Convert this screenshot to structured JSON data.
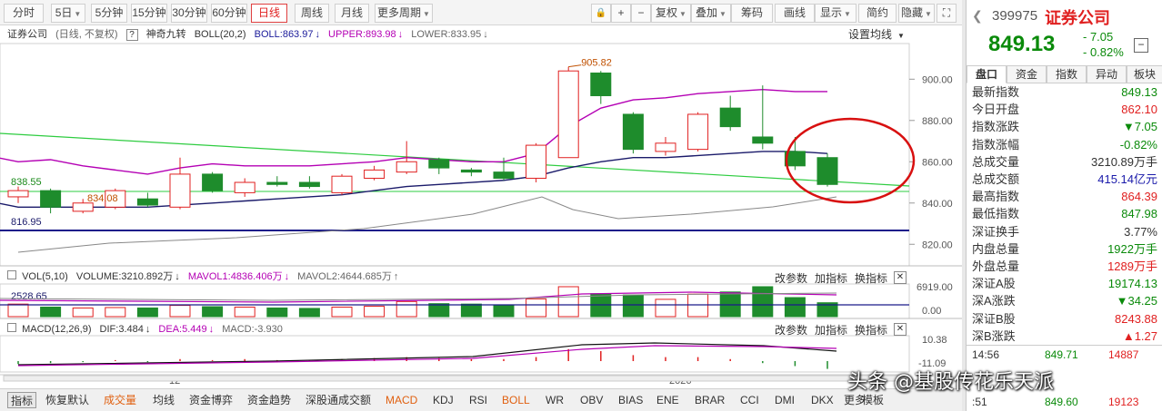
{
  "toolbar": {
    "period_buttons": [
      {
        "label": "分时",
        "dropdown": false
      },
      {
        "label": "5日",
        "dropdown": true
      },
      {
        "label": "5分钟",
        "dropdown": false
      },
      {
        "label": "15分钟",
        "dropdown": false
      },
      {
        "label": "30分钟",
        "dropdown": false
      },
      {
        "label": "60分钟",
        "dropdown": false
      },
      {
        "label": "日线",
        "dropdown": false,
        "active": true
      },
      {
        "label": "周线",
        "dropdown": false
      },
      {
        "label": "月线",
        "dropdown": false
      },
      {
        "label": "更多周期",
        "dropdown": true
      }
    ],
    "lock_icon": "lock-icon",
    "zoom_in_label": "+",
    "zoom_out_label": "−",
    "right_buttons": [
      {
        "label": "复权",
        "dropdown": true
      },
      {
        "label": "叠加",
        "dropdown": true
      },
      {
        "label": "筹码",
        "dropdown": false
      },
      {
        "label": "画线",
        "dropdown": false
      },
      {
        "label": "显示",
        "dropdown": true
      },
      {
        "label": "简约",
        "dropdown": false
      },
      {
        "label": "隐藏",
        "dropdown": true
      }
    ],
    "fullscreen_icon": "fullscreen-icon"
  },
  "main_header": {
    "stock_name": "证券公司",
    "mode": "(日线, 不复权)",
    "help": "?",
    "indicator_name": "神奇九转",
    "boll_label": "BOLL(20,2)",
    "boll_value": "BOLL:863.97",
    "upper_value": "UPPER:893.98",
    "lower_value": "LOWER:833.95",
    "settings_label": "设置均线"
  },
  "price_axis": [
    "900.00",
    "880.00",
    "860.00",
    "840.00",
    "820.00"
  ],
  "annotations": {
    "high_marker": "905.82",
    "low_marker": "834.08",
    "green_line_label": "838.55",
    "blue_line_label": "816.95"
  },
  "vol_header": {
    "name": "VOL(5,10)",
    "volume": "VOLUME:3210.892万",
    "mavol1": "MAVOL1:4836.406万",
    "mavol2": "MAVOL2:4644.685万",
    "change_params": "改参数",
    "add_indicator": "加指标",
    "switch_indicator": "换指标",
    "close": "✕",
    "axis_top": "6919.00",
    "axis_bottom": "0.00",
    "ref_line": "2528.65"
  },
  "macd_header": {
    "name": "MACD(12,26,9)",
    "dif": "DIF:3.484",
    "dea": "DEA:5.449",
    "macd": "MACD:-3.930",
    "change_params": "改参数",
    "add_indicator": "加指标",
    "switch_indicator": "换指标",
    "close": "✕",
    "axis_top": "10.38",
    "axis_bottom": "-11.09"
  },
  "x_axis": {
    "label_12": "12",
    "label_2026": "2026"
  },
  "bottom_tabs": [
    {
      "label": "指标",
      "style": "first"
    },
    {
      "label": "恢复默认",
      "style": ""
    },
    {
      "label": "成交量",
      "style": "hl"
    },
    {
      "label": "均线",
      "style": ""
    },
    {
      "label": "资金博弈",
      "style": ""
    },
    {
      "label": "资金趋势",
      "style": ""
    },
    {
      "label": "深股通成交额",
      "style": ""
    },
    {
      "label": "MACD",
      "style": "hl"
    },
    {
      "label": "KDJ",
      "style": ""
    },
    {
      "label": "RSI",
      "style": ""
    },
    {
      "label": "BOLL",
      "style": "hl"
    },
    {
      "label": "WR",
      "style": ""
    },
    {
      "label": "OBV",
      "style": ""
    },
    {
      "label": "BIAS",
      "style": ""
    },
    {
      "label": "ENE",
      "style": ""
    },
    {
      "label": "BRAR",
      "style": ""
    },
    {
      "label": "CCI",
      "style": ""
    },
    {
      "label": "DMI",
      "style": ""
    },
    {
      "label": "DKX",
      "style": ""
    },
    {
      "label": "更多",
      "style": ""
    },
    {
      "label": "模板",
      "style": ""
    }
  ],
  "quote": {
    "code": "399975",
    "name": "证券公司",
    "price": "849.13",
    "change": "- 7.05",
    "change_pct": "- 0.82%",
    "tabs": [
      "盘口",
      "资金",
      "指数",
      "异动",
      "板块"
    ],
    "rows": [
      {
        "label": "最新指数",
        "value": "849.13",
        "color": "#0a8a0a"
      },
      {
        "label": "今日开盘",
        "value": "862.10",
        "color": "#e02020"
      },
      {
        "label": "指数涨跌",
        "value": "▼7.05",
        "color": "#0a8a0a"
      },
      {
        "label": "指数涨幅",
        "value": "-0.82%",
        "color": "#0a8a0a"
      },
      {
        "label": "总成交量",
        "value": "3210.89万手",
        "color": "#333333"
      },
      {
        "label": "总成交额",
        "value": "415.14亿元",
        "color": "#1a1aaa"
      },
      {
        "label": "最高指数",
        "value": "864.39",
        "color": "#e02020"
      },
      {
        "label": "最低指数",
        "value": "847.98",
        "color": "#0a8a0a"
      },
      {
        "label": "深证换手",
        "value": "3.77%",
        "color": "#333333"
      },
      {
        "label": "内盘总量",
        "value": "1922万手",
        "color": "#0a8a0a"
      },
      {
        "label": "外盘总量",
        "value": "1289万手",
        "color": "#e02020"
      },
      {
        "label": "深证A股",
        "value": "19174.13",
        "color": "#0a8a0a"
      },
      {
        "label": "深A涨跌",
        "value": "▼34.25",
        "color": "#0a8a0a"
      },
      {
        "label": "深证B股",
        "value": "8243.88",
        "color": "#e02020"
      },
      {
        "label": "深B涨跌",
        "value": "▲1.27",
        "color": "#e02020"
      }
    ],
    "ticks": [
      {
        "time": "14:56",
        "price": "849.71",
        "vol": "14887"
      },
      {
        "time": ":51",
        "price": "849.60",
        "vol": "19123"
      }
    ]
  },
  "watermark": "头条 @基股传花乐天派",
  "colors": {
    "up": "#e02020",
    "down": "#1e8c2c",
    "upper_band": "#b400b4",
    "mid_band": "#1a1a6a",
    "ma_green": "#2ecc40",
    "highlight_circle": "#d81010"
  },
  "chart_data": {
    "type": "candlestick",
    "title": "证券公司 (日线, 不复权)",
    "y_range": [
      810,
      912
    ],
    "candles": [
      {
        "o": 843,
        "h": 848,
        "l": 840,
        "c": 846,
        "up": true
      },
      {
        "o": 846,
        "h": 847,
        "l": 835,
        "c": 838,
        "up": false
      },
      {
        "o": 836,
        "h": 842,
        "l": 835,
        "c": 840,
        "up": true
      },
      {
        "o": 838,
        "h": 847,
        "l": 837,
        "c": 846,
        "up": true
      },
      {
        "o": 842,
        "h": 845,
        "l": 838,
        "c": 839,
        "up": false
      },
      {
        "o": 838,
        "h": 862,
        "l": 837,
        "c": 854,
        "up": true
      },
      {
        "o": 854,
        "h": 855,
        "l": 845,
        "c": 846,
        "up": false
      },
      {
        "o": 845,
        "h": 852,
        "l": 843,
        "c": 850,
        "up": true
      },
      {
        "o": 850,
        "h": 853,
        "l": 848,
        "c": 849,
        "up": false
      },
      {
        "o": 850,
        "h": 853,
        "l": 847,
        "c": 848,
        "up": false
      },
      {
        "o": 845,
        "h": 854,
        "l": 844,
        "c": 853,
        "up": true
      },
      {
        "o": 852,
        "h": 858,
        "l": 851,
        "c": 856,
        "up": true
      },
      {
        "o": 855,
        "h": 870,
        "l": 854,
        "c": 860,
        "up": true
      },
      {
        "o": 861,
        "h": 862,
        "l": 854,
        "c": 857,
        "up": false
      },
      {
        "o": 856,
        "h": 857,
        "l": 853,
        "c": 855,
        "up": false
      },
      {
        "o": 855,
        "h": 862,
        "l": 851,
        "c": 852,
        "up": false
      },
      {
        "o": 852,
        "h": 869,
        "l": 850,
        "c": 868,
        "up": true
      },
      {
        "o": 862,
        "h": 906,
        "l": 862,
        "c": 904,
        "up": true
      },
      {
        "o": 903,
        "h": 904,
        "l": 888,
        "c": 892,
        "up": false
      },
      {
        "o": 883,
        "h": 884,
        "l": 864,
        "c": 866,
        "up": false
      },
      {
        "o": 865,
        "h": 872,
        "l": 863,
        "c": 869,
        "up": true
      },
      {
        "o": 866,
        "h": 884,
        "l": 865,
        "c": 883,
        "up": true
      },
      {
        "o": 886,
        "h": 892,
        "l": 875,
        "c": 877,
        "up": false
      },
      {
        "o": 872,
        "h": 897,
        "l": 866,
        "c": 869,
        "up": false
      },
      {
        "o": 865,
        "h": 872,
        "l": 856,
        "c": 858,
        "up": false
      },
      {
        "o": 862,
        "h": 864,
        "l": 848,
        "c": 849,
        "up": false
      }
    ],
    "upper_band": [
      860,
      861,
      858,
      856,
      854,
      857,
      859,
      858,
      858,
      858,
      859,
      860,
      862,
      861,
      860,
      860,
      864,
      877,
      886,
      890,
      891,
      893,
      894,
      895,
      894,
      894
    ],
    "mid_band": [
      838,
      838,
      838,
      838,
      838,
      839,
      840,
      841,
      842,
      843,
      844,
      846,
      848,
      849,
      850,
      851,
      853,
      857,
      860,
      862,
      862,
      863,
      864,
      865,
      865,
      864
    ],
    "green_line": [
      [
        0,
        872
      ],
      [
        25,
        840
      ]
    ],
    "volume": [
      {
        "v": 2900,
        "up": true
      },
      {
        "v": 2200,
        "up": false
      },
      {
        "v": 2000,
        "up": true
      },
      {
        "v": 2100,
        "up": true
      },
      {
        "v": 2000,
        "up": false
      },
      {
        "v": 2600,
        "up": true
      },
      {
        "v": 2300,
        "up": false
      },
      {
        "v": 2200,
        "up": true
      },
      {
        "v": 2000,
        "up": false
      },
      {
        "v": 1900,
        "up": false
      },
      {
        "v": 2200,
        "up": true
      },
      {
        "v": 2400,
        "up": true
      },
      {
        "v": 3500,
        "up": true
      },
      {
        "v": 3000,
        "up": false
      },
      {
        "v": 2900,
        "up": false
      },
      {
        "v": 2700,
        "up": false
      },
      {
        "v": 4100,
        "up": true
      },
      {
        "v": 6919,
        "up": true
      },
      {
        "v": 5300,
        "up": false
      },
      {
        "v": 5000,
        "up": false
      },
      {
        "v": 4000,
        "up": true
      },
      {
        "v": 5200,
        "up": true
      },
      {
        "v": 5700,
        "up": false
      },
      {
        "v": 6919,
        "up": false
      },
      {
        "v": 4400,
        "up": false
      },
      {
        "v": 3211,
        "up": false
      }
    ],
    "macd_hist": [
      -1.5,
      -1,
      -0.5,
      0.5,
      -0.5,
      1,
      0.5,
      1,
      0.5,
      0.5,
      1,
      1.5,
      2,
      1.5,
      1,
      1,
      2,
      6,
      5,
      3,
      2,
      2,
      1,
      -1,
      -2.5,
      -3.9
    ]
  }
}
